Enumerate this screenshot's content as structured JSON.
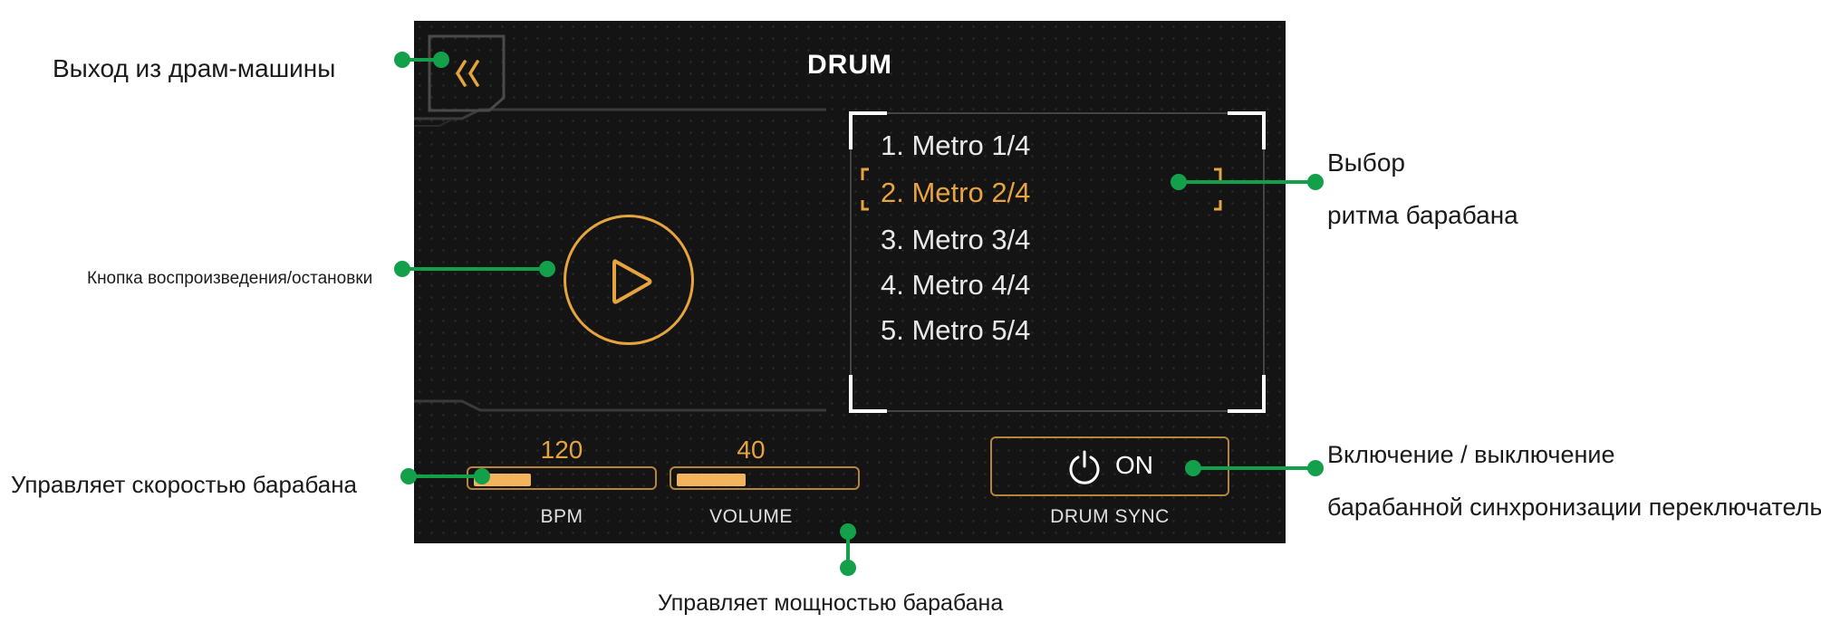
{
  "screen": {
    "title": "DRUM",
    "rhythms": [
      {
        "label": "1. Metro 1/4",
        "selected": false
      },
      {
        "label": "2. Metro 2/4",
        "selected": true
      },
      {
        "label": "3. Metro 3/4",
        "selected": false
      },
      {
        "label": "4. Metro 4/4",
        "selected": false
      },
      {
        "label": "5. Metro 5/4",
        "selected": false
      }
    ],
    "bpm": {
      "value": "120",
      "label": "BPM",
      "level_fraction": 0.33
    },
    "volume": {
      "value": "40",
      "label": "VOLUME",
      "level_fraction": 0.4
    },
    "drum_sync": {
      "state": "ON",
      "label": "DRUM SYNC"
    }
  },
  "annotations": {
    "exit": "Выход из драм-машины",
    "play_stop": "Кнопка воспроизведения/остановки",
    "rhythm_select_line1": "Выбор",
    "rhythm_select_line2": "ритма барабана",
    "bpm_control": "Управляет скоростью барабана",
    "volume_control": "Управляет мощностью барабана",
    "sync_line1": "Включение / выключение",
    "sync_line2": "барабанной синхронизации переключатель"
  },
  "colors": {
    "accent": "#e6a43f",
    "screen_bg": "#141414",
    "callout": "#14a04b",
    "text": "#1a1a1a"
  },
  "icons": [
    "chevron-left-double-icon",
    "play-icon",
    "power-icon"
  ]
}
